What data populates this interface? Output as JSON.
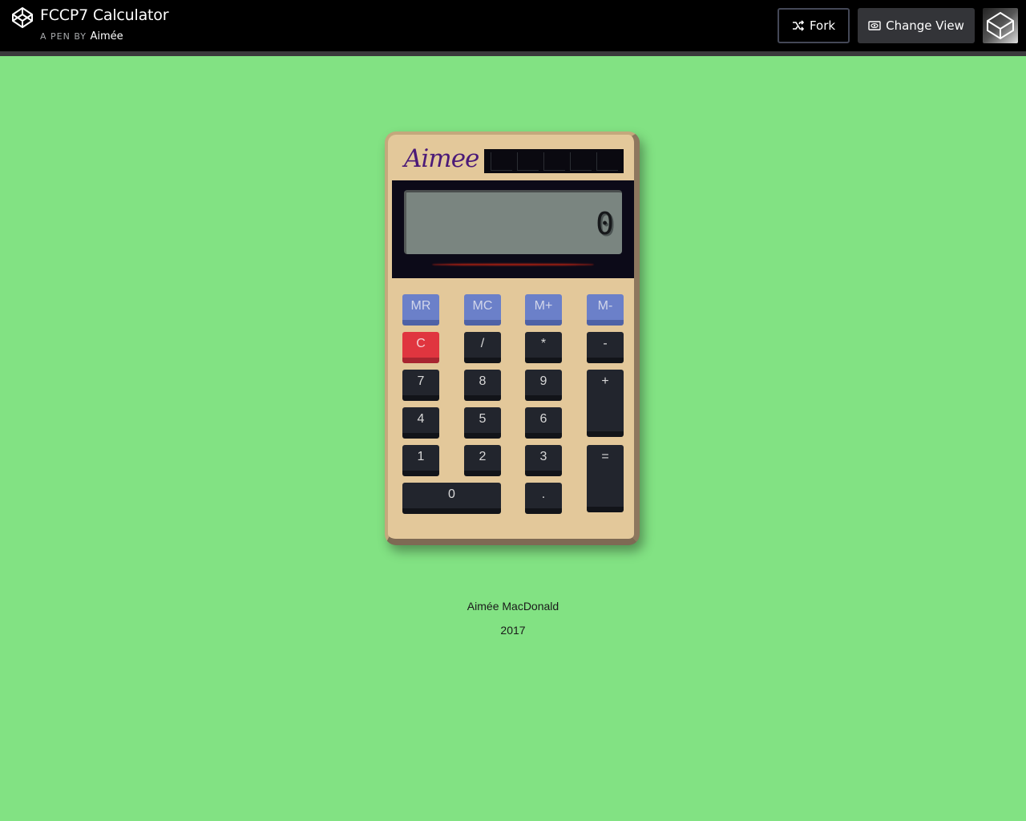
{
  "header": {
    "title": "FCCP7 Calculator",
    "byline_prefix": "A PEN BY",
    "author": "Aimée",
    "fork_label": "Fork",
    "change_view_label": "Change View",
    "logo_icon": "codepen-logo-icon",
    "fork_icon": "fork-icon",
    "change_view_icon": "eye-icon"
  },
  "calculator": {
    "brand": "Aimee",
    "display": "0",
    "keys": {
      "mr": "MR",
      "mc": "MC",
      "mplus": "M+",
      "mminus": "M-",
      "clear": "C",
      "divide": "/",
      "multiply": "*",
      "subtract": "-",
      "k7": "7",
      "k8": "8",
      "k9": "9",
      "add": "+",
      "k4": "4",
      "k5": "5",
      "k6": "6",
      "k1": "1",
      "k2": "2",
      "k3": "3",
      "equals": "=",
      "k0": "0",
      "decimal": "."
    }
  },
  "footer": {
    "name": "Aimée MacDonald",
    "year": "2017"
  },
  "colors": {
    "background": "#82e283",
    "calculator_body": "#e3c89a",
    "memory_key": "#6b80c9",
    "clear_key": "#e0353f",
    "key": "#22252d"
  }
}
